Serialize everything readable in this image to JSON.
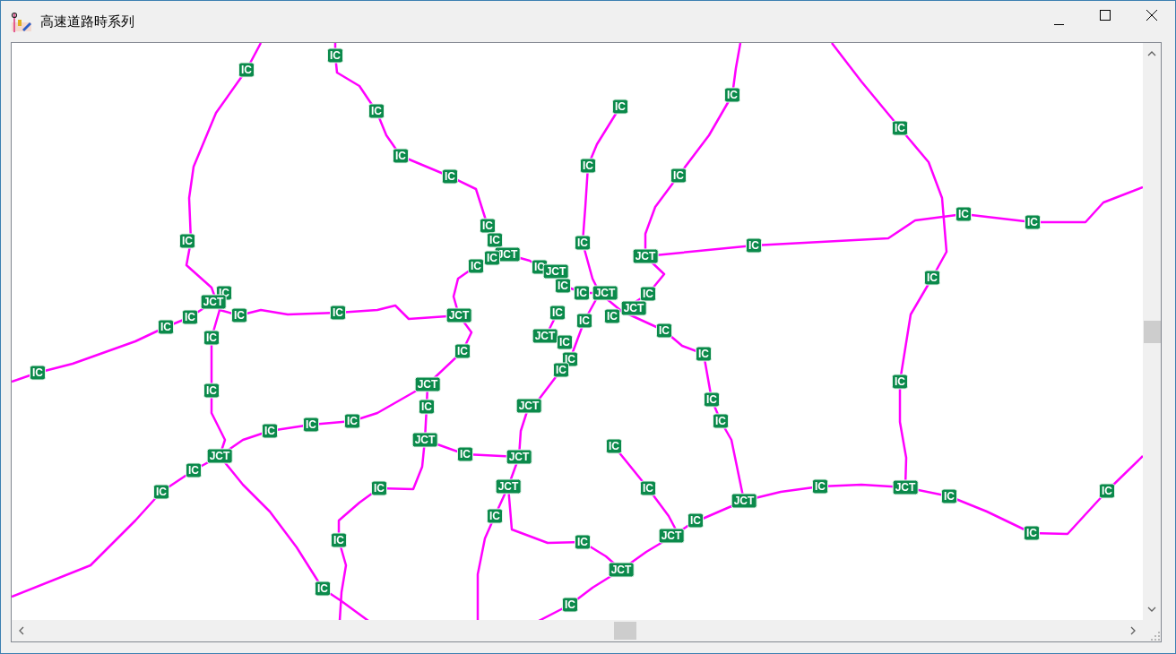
{
  "window": {
    "title": "高速道路時系列"
  },
  "map": {
    "markers": [
      {
        "label": "IC"
      },
      {
        "label": "IC"
      },
      {
        "label": "IC"
      },
      {
        "label": "IC"
      },
      {
        "label": "IC"
      },
      {
        "label": "IC"
      },
      {
        "label": "IC"
      },
      {
        "label": "IC"
      },
      {
        "label": "IC"
      },
      {
        "label": "IC"
      },
      {
        "label": "IC"
      },
      {
        "label": "IC"
      },
      {
        "label": "IC"
      },
      {
        "label": "IC"
      },
      {
        "label": "JCT"
      },
      {
        "label": "IC"
      },
      {
        "label": "IC"
      },
      {
        "label": "JCT"
      },
      {
        "label": "IC"
      },
      {
        "label": "IC"
      },
      {
        "label": "IC"
      },
      {
        "label": "IC"
      },
      {
        "label": "JCT"
      },
      {
        "label": "IC"
      },
      {
        "label": "IC"
      },
      {
        "label": "JCT"
      },
      {
        "label": "IC"
      },
      {
        "label": "IC"
      },
      {
        "label": "JCT"
      },
      {
        "label": "IC"
      },
      {
        "label": "JCT"
      },
      {
        "label": "IC"
      },
      {
        "label": "IC"
      },
      {
        "label": "IC"
      },
      {
        "label": "JCT"
      },
      {
        "label": "IC"
      },
      {
        "label": "IC"
      },
      {
        "label": "IC"
      },
      {
        "label": "IC"
      },
      {
        "label": "IC"
      },
      {
        "label": "IC"
      },
      {
        "label": "JCT"
      },
      {
        "label": "IC"
      },
      {
        "label": "IC"
      },
      {
        "label": "IC"
      },
      {
        "label": "IC"
      },
      {
        "label": "IC"
      },
      {
        "label": "IC"
      },
      {
        "label": "IC"
      },
      {
        "label": "JCT"
      },
      {
        "label": "IC"
      },
      {
        "label": "IC"
      },
      {
        "label": "JCT"
      },
      {
        "label": "IC"
      },
      {
        "label": "IC"
      },
      {
        "label": "IC"
      },
      {
        "label": "IC"
      },
      {
        "label": "IC"
      },
      {
        "label": "JCT"
      },
      {
        "label": "IC"
      },
      {
        "label": "JCT"
      },
      {
        "label": "IC"
      },
      {
        "label": "JCT"
      },
      {
        "label": "IC"
      },
      {
        "label": "IC"
      },
      {
        "label": "IC"
      },
      {
        "label": "JCT"
      },
      {
        "label": "IC"
      },
      {
        "label": "JCT"
      },
      {
        "label": "IC"
      },
      {
        "label": "JCT"
      },
      {
        "label": "IC"
      },
      {
        "label": "IC"
      },
      {
        "label": "IC"
      },
      {
        "label": "IC"
      },
      {
        "label": "IC"
      },
      {
        "label": "JCT"
      },
      {
        "label": "IC"
      },
      {
        "label": "IC"
      },
      {
        "label": "IC"
      },
      {
        "label": "IC"
      },
      {
        "label": "JCT"
      }
    ]
  }
}
